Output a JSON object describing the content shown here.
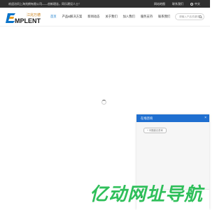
{
  "topbar": {
    "welcome": "欢迎访问上海兆朗有限公司——创新理念，同乐建设人士！",
    "link_contact": "网站地图",
    "link_about": "联系我们",
    "lang": "中文"
  },
  "logo": {
    "cn": "江兆万德",
    "en": "MPLENT",
    "letter": "E"
  },
  "nav": {
    "items": [
      "首页",
      "产品&解决方案",
      "新闻动态",
      "关于我们",
      "加入我们",
      "服务支持",
      "联系我们"
    ]
  },
  "search": {
    "placeholder": "请输入产品关键词"
  },
  "chat": {
    "title": "在线咨询",
    "close": "×",
    "chip": "+ 问题建议咨询"
  },
  "watermark": {
    "text": "亿动网址导航"
  },
  "colors": {
    "accent": "#1f6fd0",
    "topbar": "#2f2f2f",
    "watermark_green": "#2fbf5a"
  }
}
